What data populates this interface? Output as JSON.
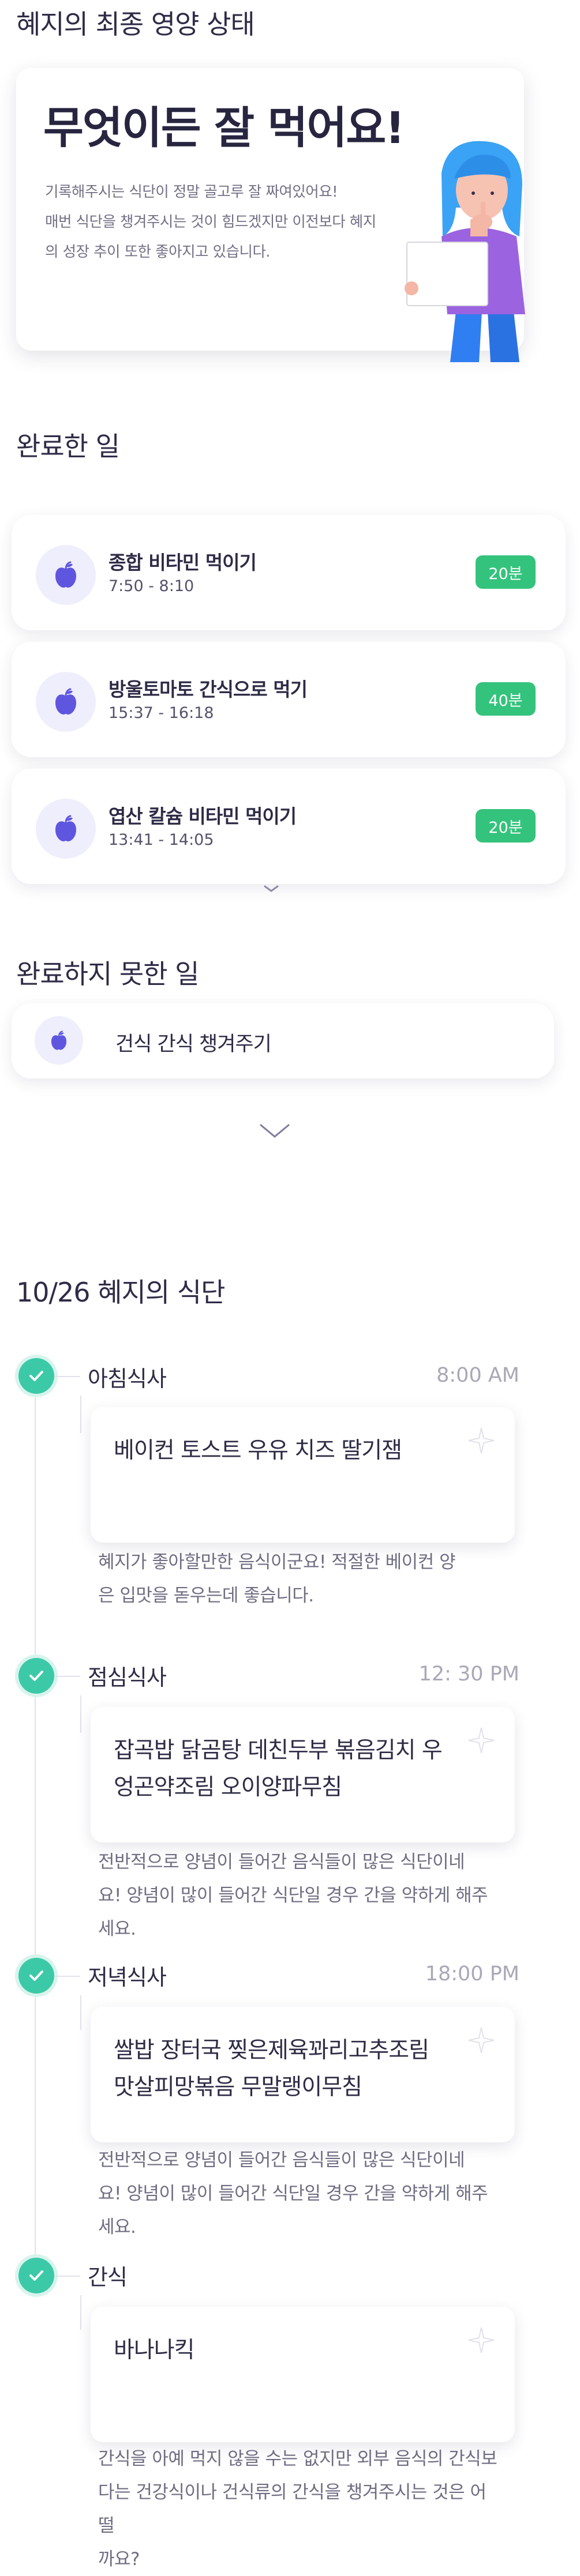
{
  "status": {
    "section_title": "혜지의 최종 영양 상태",
    "headline": "무엇이든 잘 먹어요!",
    "desc_line1": "기록해주시는 식단이 정말 골고루 잘 짜여있어요!",
    "desc_line2": "매번 식단을 챙겨주시는 것이 힘드겠지만 이전보다 혜지",
    "desc_line3": "의 성장 추이 또한 좋아지고 있습니다."
  },
  "done": {
    "section_title": "완료한 일",
    "tasks": [
      {
        "name": "종합 비타민 먹이기",
        "time": "7:50 - 8:10",
        "badge": "20분",
        "icon": "apple-icon"
      },
      {
        "name": "방울토마토 간식으로 먹기",
        "time": "15:37 - 16:18",
        "badge": "40분",
        "icon": "apple-icon"
      },
      {
        "name": "엽산 칼슘 비타민 먹이기",
        "time": "13:41 - 14:05",
        "badge": "20분",
        "icon": "apple-icon"
      }
    ]
  },
  "undone": {
    "section_title": "완료하지 못한 일",
    "tasks": [
      {
        "name": "건식 간식 챙겨주기",
        "icon": "apple-icon"
      }
    ]
  },
  "diet": {
    "section_title": "10/26 혜지의 식단",
    "meals": [
      {
        "title": "아침식사",
        "time": "8:00 AM",
        "menu": "베이컨 토스트 우유 치즈 딸기잼",
        "comment_line1": "혜지가 좋아할만한 음식이군요! 적절한 베이컨 양",
        "comment_line2": "은 입맛을 돋우는데 좋습니다."
      },
      {
        "title": "점심식사",
        "time": "12: 30 PM",
        "menu_line1": "잡곡밥 닭곰탕 데친두부 볶음김치 우",
        "menu_line2": "엉곤약조림 오이양파무침",
        "comment_line1": "전반적으로 양념이 들어간 음식들이 많은 식단이네",
        "comment_line2": "요! 양념이 많이 들어간 식단일 경우 간을 약하게 해주",
        "comment_line3": "세요."
      },
      {
        "title": "저녁식사",
        "time": "18:00 PM",
        "menu_line1": "쌀밥 장터국 찢은제육꽈리고추조림",
        "menu_line2": "맛살피망볶음 무말랭이무침",
        "comment_line1": "전반적으로 양념이 들어간 음식들이 많은 식단이네",
        "comment_line2": "요! 양념이 많이 들어간 식단일 경우 간을 약하게 해주",
        "comment_line3": "세요."
      },
      {
        "title": "간식",
        "time": "",
        "menu": "바나나킥",
        "comment_line1": "간식을 아예 먹지 않을 수는 없지만 외부 음식의 간식보",
        "comment_line2": "다는 건강식이나 건식류의 간식을 챙겨주시는 것은 어떨",
        "comment_line3": "까요?"
      }
    ]
  },
  "colors": {
    "accent_purple": "#5f56e0",
    "badge_green": "#34c37c",
    "check_teal": "#3cc9a7"
  }
}
